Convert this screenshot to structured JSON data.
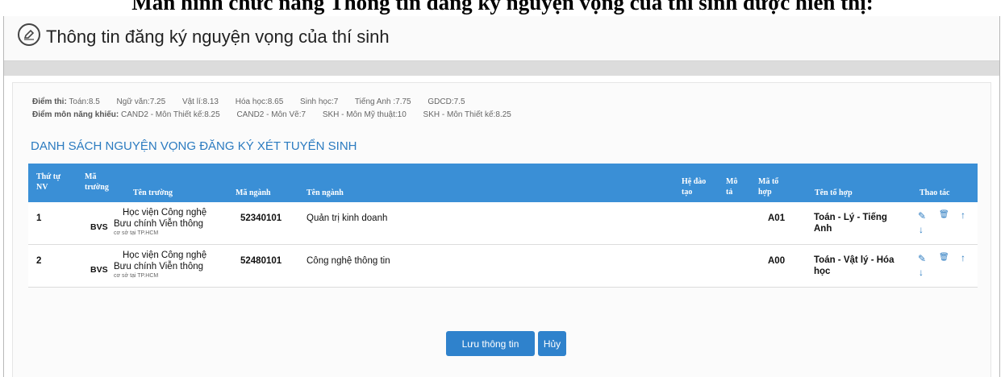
{
  "top_cut_heading": "Màn hình chức năng Thông tin đăng ký nguyện vọng của thí sinh được hiển thị:",
  "header": {
    "title": "Thông tin đăng ký nguyện vọng của thí sinh",
    "icon": "edit-icon"
  },
  "scores": {
    "exam_label": "Điểm thi:",
    "exam_items": [
      "Toán:8.5",
      "Ngữ văn:7.25",
      "Vật lí:8.13",
      "Hóa học:8.65",
      "Sinh học:7",
      "Tiếng Anh :7.75",
      "GDCD:7.5"
    ],
    "aptitude_label": "Điểm môn năng khiếu:",
    "aptitude_items": [
      "CAND2 - Môn Thiết kế:8.25",
      "CAND2 - Môn Vẽ:7",
      "SKH - Môn Mỹ thuật:10",
      "SKH - Môn Thiết kế:8.25"
    ]
  },
  "list_title": "DANH SÁCH NGUYỆN VỌNG ĐĂNG KÝ XÉT TUYỂN SINH",
  "table": {
    "headers": {
      "order_1": "Thứ tự",
      "order_2": "NV",
      "school_code_1": "Mã",
      "school_code_2": "trường",
      "school_name": "Tên trường",
      "major_code": "Mã ngành",
      "major_name": "Tên ngành",
      "training_1": "Hệ đào",
      "training_2": "tạo",
      "desc_1": "Mô",
      "desc_2": "tả",
      "combo_code_1": "Mã tổ",
      "combo_code_2": "hợp",
      "combo_name": "Tên tổ hợp",
      "actions": "Thao tác"
    },
    "rows": [
      {
        "order": "1",
        "school_code": "BVS",
        "school_name_1": "Học viện Công nghệ",
        "school_name_2": "Bưu chính Viễn thông",
        "campus": "cơ sở tại TP.HCM",
        "major_code": "52340101",
        "major_name": "Quản trị kinh doanh",
        "combo_code": "A01",
        "combo_name_1": "Toán - Lý - Tiếng",
        "combo_name_2": "Anh"
      },
      {
        "order": "2",
        "school_code": "BVS",
        "school_name_1": "Học viện Công nghệ",
        "school_name_2": "Bưu chính Viễn thông",
        "campus": "cơ sở tại TP.HCM",
        "major_code": "52480101",
        "major_name": "Công nghệ thông tin",
        "combo_code": "A00",
        "combo_name_1": "Toán - Vật lý - Hóa",
        "combo_name_2": "học"
      }
    ],
    "action_icons": {
      "edit": "✎",
      "delete": "🗑",
      "up": "↑",
      "down": "↓"
    }
  },
  "buttons": {
    "save": "Lưu thông tin",
    "cancel": "Hủy"
  },
  "colors": {
    "accent": "#2f82cc",
    "header_bg": "#3a8fd6",
    "title": "#2b7bc0"
  }
}
